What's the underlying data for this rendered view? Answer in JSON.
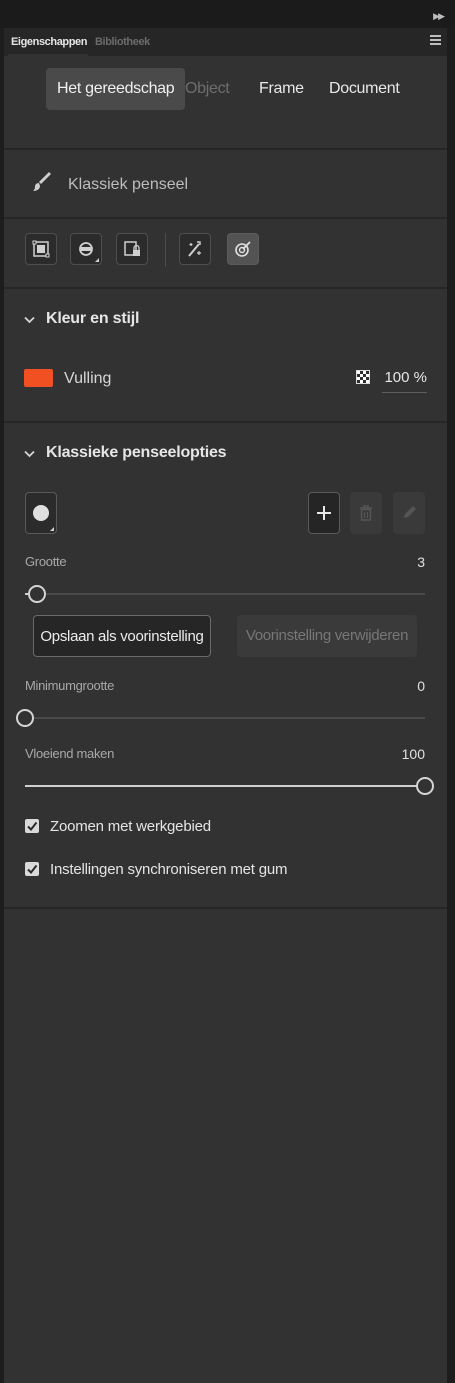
{
  "panel_tabs": {
    "properties": "Eigenschappen",
    "library": "Bibliotheek"
  },
  "context_tabs": [
    {
      "label": "Het gereedschap",
      "state": "selected"
    },
    {
      "label": "Object",
      "state": "disabled"
    },
    {
      "label": "Frame",
      "state": "normal"
    },
    {
      "label": "Document",
      "state": "normal"
    }
  ],
  "tool": {
    "name": "Klassiek penseel",
    "icon": "brush-icon"
  },
  "toolbar": {
    "buttons": [
      {
        "icon": "object-drawing-icon"
      },
      {
        "icon": "brush-mode-icon"
      },
      {
        "icon": "lock-fill-icon"
      },
      {
        "icon": "pressure-icon"
      },
      {
        "icon": "tilt-icon",
        "selected": true
      }
    ]
  },
  "kleur_en_stijl": {
    "title": "Kleur en stijl",
    "fill_label": "Vulling",
    "fill_color": "#f05022",
    "opacity": "100 %"
  },
  "penseelopties": {
    "title": "Klassieke penseelopties",
    "sliders": [
      {
        "label": "Grootte",
        "value": "3",
        "fraction": 0.03
      },
      {
        "label": "Minimumgrootte",
        "value": "0",
        "fraction": 0.0
      },
      {
        "label": "Vloeiend maken",
        "value": "100",
        "fraction": 1.0
      }
    ],
    "save_preset": "Opslaan als voorinstelling",
    "remove_preset": "Voorinstelling verwijderen",
    "checkboxes": [
      {
        "label": "Zoomen met werkgebied",
        "checked": true
      },
      {
        "label": "Instellingen synchroniseren met gum",
        "checked": true
      }
    ]
  }
}
